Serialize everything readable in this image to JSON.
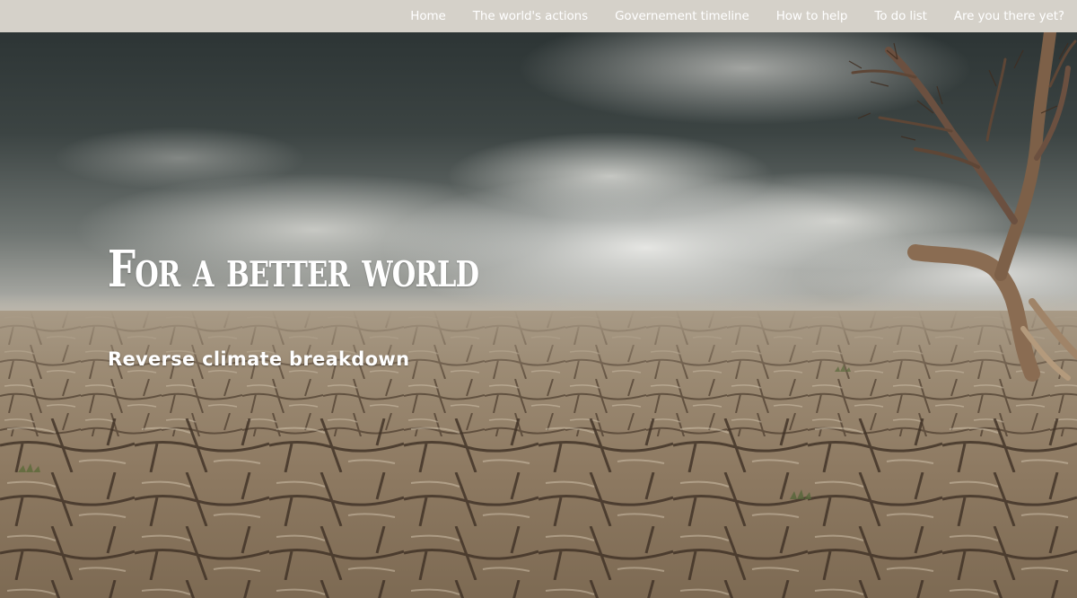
{
  "nav": {
    "items": [
      {
        "label": "Home"
      },
      {
        "label": "The world's actions"
      },
      {
        "label": "Governement timeline"
      },
      {
        "label": "How to help"
      },
      {
        "label": "To do list"
      },
      {
        "label": "Are you there yet?"
      }
    ]
  },
  "hero": {
    "title": "For a better world",
    "subtitle": "Reverse climate breakdown",
    "background_icon": "cracked-desert-landscape-image"
  },
  "colors": {
    "nav_background": "#d5d1c9",
    "nav_text": "#ffffff",
    "hero_text": "#ffffff"
  }
}
